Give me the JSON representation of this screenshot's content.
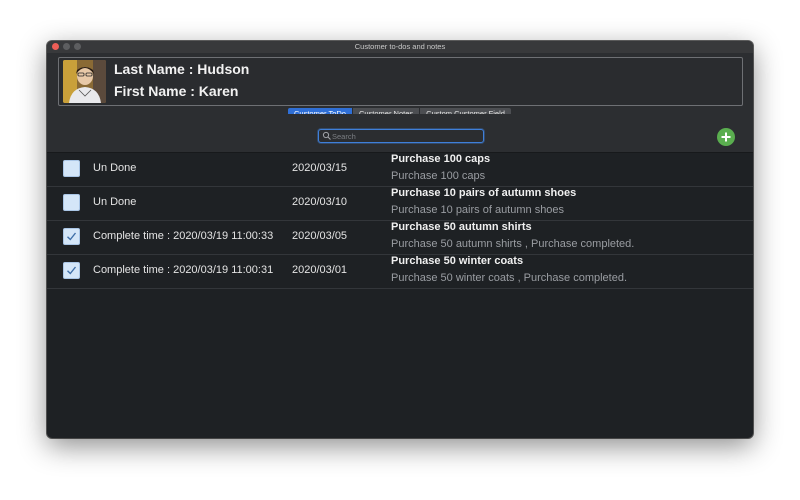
{
  "window": {
    "title": "Customer to-dos and notes"
  },
  "customer": {
    "last_name_line": "Last Name : Hudson",
    "first_name_line": "First Name : Karen"
  },
  "tabs": [
    {
      "label": "Customer ToDo",
      "active": true
    },
    {
      "label": "Customer Notes",
      "active": false
    },
    {
      "label": "Custom Customer Field",
      "active": false
    }
  ],
  "search": {
    "placeholder": "Search",
    "value": ""
  },
  "colors": {
    "accent": "#2f6fd6",
    "add_button": "#5aae4f",
    "background": "#1e2124"
  },
  "todos": [
    {
      "checked": false,
      "status": "Un Done",
      "date": "2020/03/15",
      "title": "Purchase 100 caps",
      "description": "Purchase 100 caps"
    },
    {
      "checked": false,
      "status": "Un Done",
      "date": "2020/03/10",
      "title": "Purchase 10 pairs of autumn shoes",
      "description": "Purchase 10 pairs of autumn shoes"
    },
    {
      "checked": true,
      "status": "Complete time : 2020/03/19 11:00:33",
      "date": "2020/03/05",
      "title": "Purchase 50 autumn shirts",
      "description": "Purchase 50 autumn shirts , Purchase completed."
    },
    {
      "checked": true,
      "status": "Complete time : 2020/03/19 11:00:31",
      "date": "2020/03/01",
      "title": "Purchase 50 winter coats",
      "description": "Purchase 50 winter coats , Purchase completed."
    }
  ]
}
